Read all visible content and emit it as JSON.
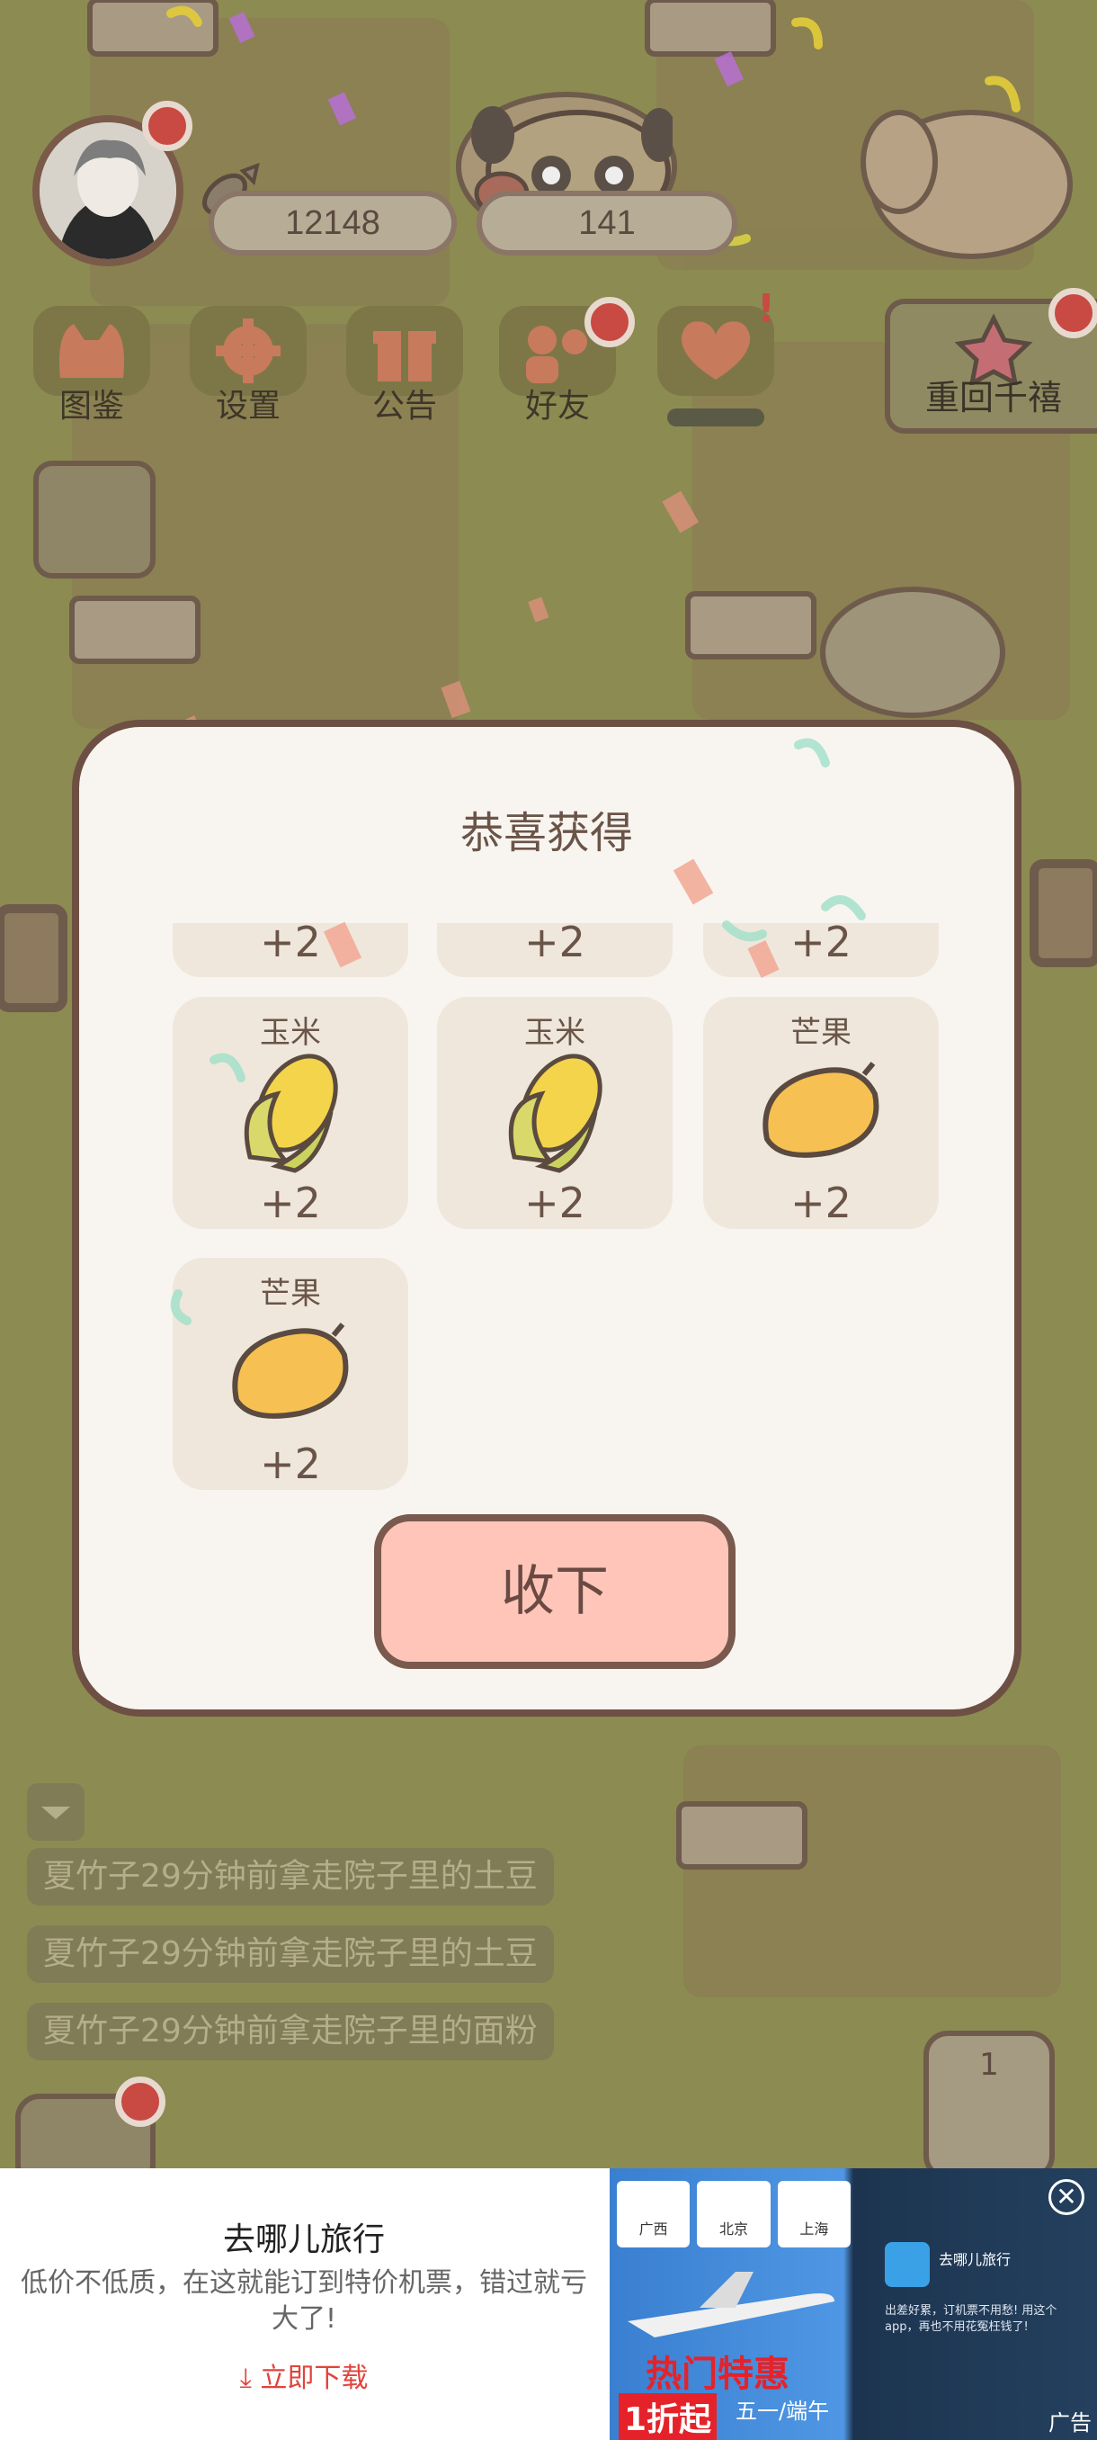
{
  "header": {
    "fish_count": "12148",
    "pug_count": "141"
  },
  "menu": [
    {
      "label": "图鉴"
    },
    {
      "label": "设置"
    },
    {
      "label": "公告"
    },
    {
      "label": "好友"
    }
  ],
  "reunion_button": "重回千禧",
  "counter_badge": "1",
  "modal": {
    "title": "恭喜获得",
    "partial_row": [
      "+2",
      "+2",
      "+2"
    ],
    "items": [
      {
        "name": "玉米",
        "qty": "+2",
        "icon": "corn-icon"
      },
      {
        "name": "玉米",
        "qty": "+2",
        "icon": "corn-icon"
      },
      {
        "name": "芒果",
        "qty": "+2",
        "icon": "mango-icon"
      },
      {
        "name": "芒果",
        "qty": "+2",
        "icon": "mango-icon"
      }
    ],
    "collect_label": "收下"
  },
  "log": [
    "夏竹子29分钟前拿走院子里的土豆",
    "夏竹子29分钟前拿走院子里的土豆",
    "夏竹子29分钟前拿走院子里的面粉"
  ],
  "ad": {
    "title": "去哪儿旅行",
    "description": "低价不低质，在这就能订到特价机票，错过就亏大了!",
    "download_label": "立即下载",
    "tag": "广告",
    "banner_headline": "热门特惠",
    "banner_sub": "五一/端午",
    "banner_price": "1折起",
    "banner_cities": [
      "广西",
      "北京",
      "上海"
    ],
    "app_name": "去哪儿旅行",
    "app_text": "出差好累，订机票不用愁! 用这个app，再也不用花冤枉钱了!"
  },
  "colors": {
    "background": "#8c8b52",
    "modal_bg": "#f8f5f0",
    "collect_button": "#ffc5b9",
    "download_red": "#e2433b"
  }
}
